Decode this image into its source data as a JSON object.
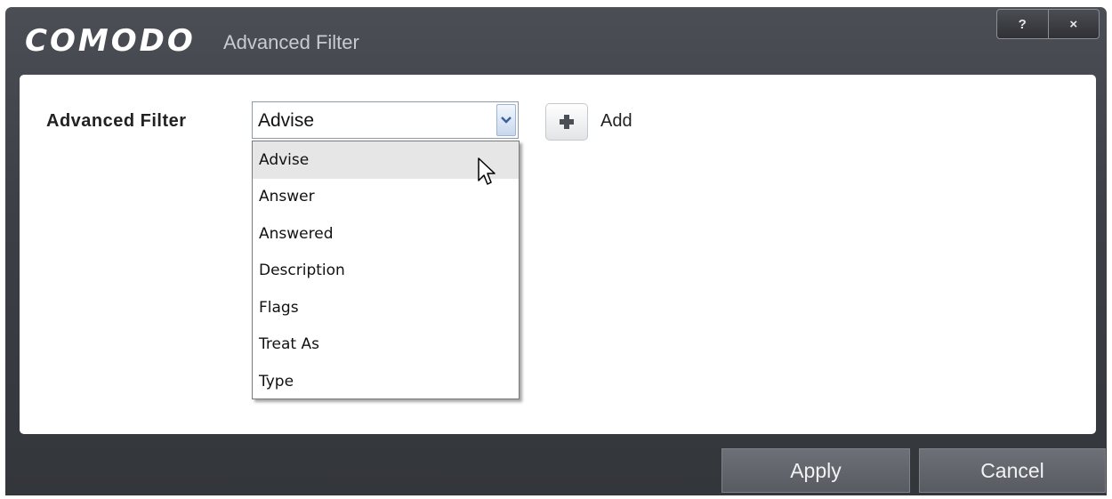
{
  "window": {
    "brand": "COMODO",
    "title": "Advanced Filter",
    "help_label": "?",
    "close_label": "×"
  },
  "filter": {
    "label": "Advanced Filter",
    "selected": "Advise",
    "add_label": "Add",
    "options": [
      "Advise",
      "Answer",
      "Answered",
      "Description",
      "Flags",
      "Treat As",
      "Type"
    ],
    "hovered_option": "Advise"
  },
  "footer": {
    "apply_label": "Apply",
    "cancel_label": "Cancel"
  },
  "icons": {
    "dropdown_arrow": "chevron-down-icon",
    "add": "plus-icon",
    "cursor": "mouse-pointer-icon"
  },
  "colors": {
    "frame": "#3d4046",
    "panel": "#ffffff",
    "button": "#62656b",
    "dropdown_hover": "#e6e6e6"
  }
}
